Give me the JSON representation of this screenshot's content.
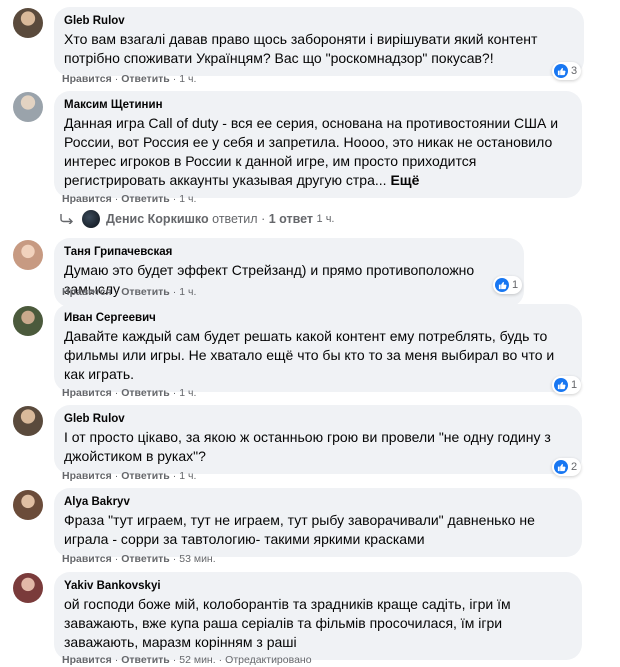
{
  "ui": {
    "like_label": "Нравится",
    "reply_label": "Ответить",
    "more_label": "Ещё",
    "separator": "·",
    "edited_label": "Отредактировано"
  },
  "comments": [
    {
      "author": "Gleb Rulov",
      "text": "Хто вам взагалі давав право щось забороняти і вирішувати який контент потрібно споживати Українцям? Вас що \"роскомнадзор\" покусав?!",
      "time": "1 ч.",
      "reactions": "3",
      "avatar_color": "#5a4a3c"
    },
    {
      "author": "Максим Щетинин",
      "text": "Данная игра Call of duty - вся ее серия, основана на противостоянии США и России, вот Россия ее у себя и запретила. Ноооо, это никак не остановило интерес игроков в России к данной игре, им просто приходится регистрировать аккаунты указывая другую стра...",
      "time": "1 ч.",
      "reactions": "",
      "avatar_color": "#9aa3ab"
    },
    {
      "author": "Таня Грипачевская",
      "text": "Думаю это будет эффект Стрейзанд) и прямо противоположно замыслу",
      "time": "1 ч.",
      "reactions": "1",
      "avatar_color": "#c79a82"
    },
    {
      "author": "Иван Сергеевич",
      "text": "Давайте каждый сам будет решать какой контент ему потреблять, будь то фильмы или игры. Не хватало ещё что бы кто то за меня выбирал во что и как играть.",
      "time": "1 ч.",
      "reactions": "1",
      "avatar_color": "#4b5a3c"
    },
    {
      "author": "Gleb Rulov",
      "text": "І от просто цікаво, за якою ж останньою грою ви провели \"не одну годину з джойстиком в руках\"?",
      "time": "1 ч.",
      "reactions": "2",
      "avatar_color": "#5a4a3c"
    },
    {
      "author": "Alya Bakryv",
      "text": "Фраза \"тут играем, тут не играем, тут рыбу заворачивали\" давненько не играла - сорри за тавтологию- такими яркими красками",
      "time": "53 мин.",
      "reactions": "",
      "avatar_color": "#6b4c3a"
    },
    {
      "author": "Yakiv Bankovskyi",
      "text": "ой господи боже мій, колоборантів та зрадників краще садіть, ігри їм заважають, вже купа раша серіалів та фільмів просочилася, їм ігри заважають, маразм корінням з раші",
      "time": "52 мин.",
      "reactions": "",
      "avatar_color": "#7a3b3b"
    }
  ],
  "reply_thread": {
    "author": "Денис Коркишко",
    "action": "ответил",
    "count_label": "1 ответ",
    "time": "1 ч."
  }
}
